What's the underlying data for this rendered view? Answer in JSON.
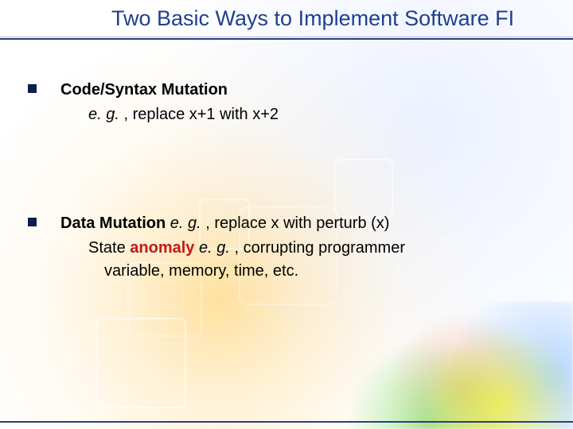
{
  "title": "Two Basic Ways to Implement Software FI",
  "items": [
    {
      "heading": "Code/Syntax Mutation",
      "sub_eg": "e. g. ",
      "sub_rest": ", replace x+1 with x+2"
    },
    {
      "heading": "Data Mutation ",
      "inline_eg": "e. g. ",
      "inline_rest": ", replace x with perturb (x)",
      "sub2_lead": "State ",
      "sub2_anomaly": "anomaly",
      "sub2_mid": " ",
      "sub2_eg": "e. g. ",
      "sub2_rest": ", corrupting programmer",
      "sub2_line2": "variable, memory, time, etc."
    }
  ]
}
